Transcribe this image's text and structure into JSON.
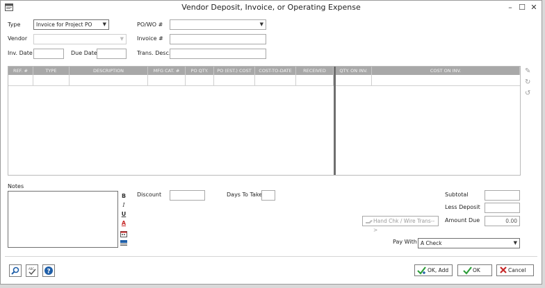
{
  "window": {
    "title": "Vendor Deposit, Invoice, or Operating Expense",
    "minimize": "–",
    "maximize": "☐",
    "close": "✕"
  },
  "form": {
    "type_label": "Type",
    "type_value": "Invoice for Project PO",
    "vendor_label": "Vendor",
    "vendor_value": "",
    "inv_date_label": "Inv. Date",
    "inv_date_value": "",
    "due_date_label": "Due Date",
    "due_date_value": "",
    "powo_label": "PO/WO #",
    "powo_value": "",
    "invoice_label": "Invoice #",
    "invoice_value": "",
    "trans_label": "Trans. Desc.",
    "trans_value": ""
  },
  "grid": {
    "columns": [
      "REF. #",
      "TYPE",
      "DESCRIPTION",
      "MFG CAT. #",
      "PO QTY.",
      "PO (EST.) COST",
      "COST-TO-DATE",
      "RECEIVED",
      "QTY. ON INV.",
      "COST ON INV."
    ]
  },
  "notes": {
    "label": "Notes",
    "value": "",
    "format": {
      "bold": "B",
      "italic": "I",
      "underline": "U",
      "color": "A"
    }
  },
  "totals": {
    "discount_label": "Discount",
    "discount_value": "",
    "days_label": "Days To Take",
    "days_value": "",
    "subtotal_label": "Subtotal",
    "subtotal_value": "",
    "less_deposit_label": "Less Deposit",
    "less_deposit_value": "",
    "amount_due_label": "Amount Due",
    "amount_due_value": "0.00",
    "hand_check_label": "Hand Chk / Wire Trans-->",
    "pay_with_label": "Pay With",
    "pay_with_value": "A Check"
  },
  "buttons": {
    "ok_add": "OK, Add",
    "ok": "OK",
    "cancel": "Cancel"
  },
  "colors": {
    "grid_header": "#a8a8a8",
    "ok_green": "#2e9e3a",
    "cancel_red": "#c62828",
    "help_blue": "#1f5fa8"
  }
}
